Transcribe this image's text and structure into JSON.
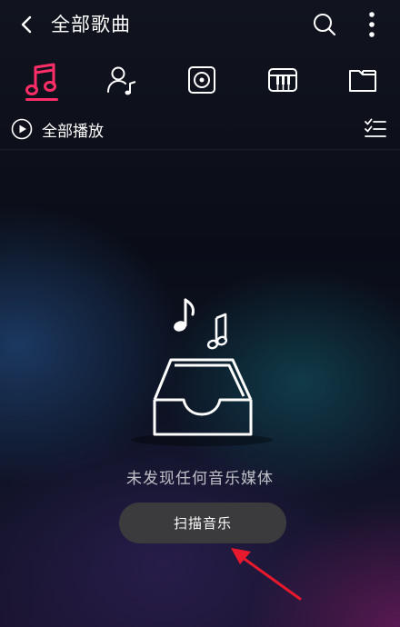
{
  "header": {
    "title": "全部歌曲",
    "back_icon": "back-chevron-icon",
    "search_icon": "search-icon",
    "more_icon": "more-vertical-icon"
  },
  "tabs": [
    {
      "icon": "music-note-icon",
      "active": true
    },
    {
      "icon": "artist-icon",
      "active": false
    },
    {
      "icon": "album-icon",
      "active": false
    },
    {
      "icon": "piano-icon",
      "active": false
    },
    {
      "icon": "folder-icon",
      "active": false
    }
  ],
  "toolbar": {
    "play_all_label": "全部播放",
    "play_icon": "play-circle-icon",
    "multiselect_icon": "multiselect-list-icon"
  },
  "empty_state": {
    "message": "未发现任何音乐媒体",
    "scan_button_label": "扫描音乐",
    "illustration_icon": "empty-box-music-icon"
  },
  "colors": {
    "accent": "#ff2d68",
    "annotation_arrow": "#e8192c",
    "button_bg": "#3b3b3e"
  }
}
